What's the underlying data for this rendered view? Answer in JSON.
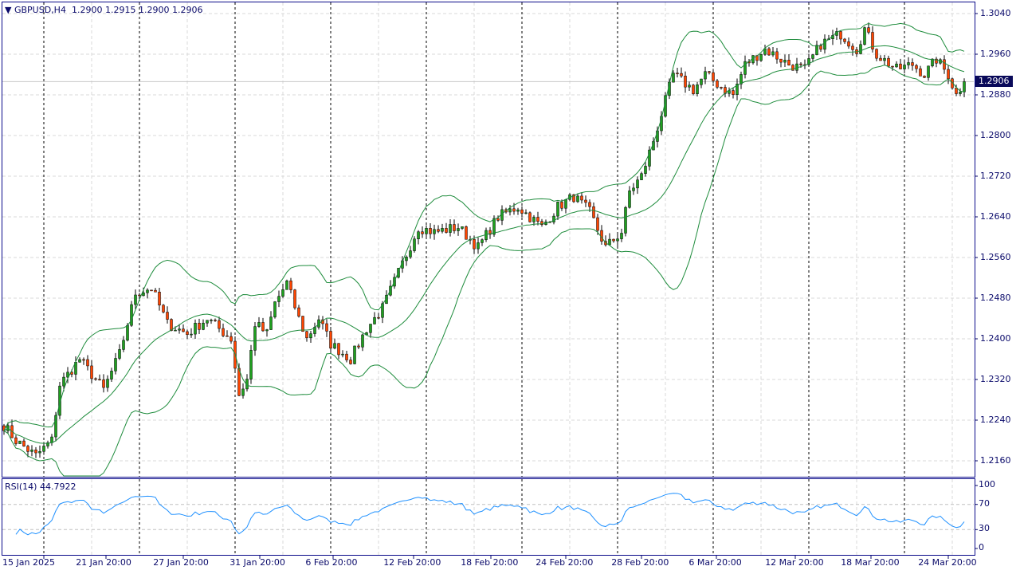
{
  "header": {
    "symbol": "GBPUSD,H4",
    "open": "1.2900",
    "high": "1.2915",
    "low": "1.2900",
    "close": "1.2906"
  },
  "current_price": "1.2906",
  "rsi": {
    "label": "RSI(14)",
    "value": "44.7922",
    "levels": [
      "100",
      "70",
      "30",
      "0"
    ]
  },
  "colors": {
    "bull": "#1ea01e",
    "bear": "#ff4500",
    "bands": "#1e8c3c",
    "rsi": "#1e90ff",
    "text": "#0a0a6a"
  },
  "chart_data": {
    "type": "candlestick",
    "title": "GBPUSD,H4",
    "y_ticks": [
      "1.3040",
      "1.2960",
      "1.2880",
      "1.2800",
      "1.2720",
      "1.2640",
      "1.2560",
      "1.2480",
      "1.2400",
      "1.2320",
      "1.2240",
      "1.2160"
    ],
    "ylim": [
      1.2104,
      1.3062
    ],
    "x_ticks": [
      "15 Jan 2025",
      "21 Jan 20:00",
      "27 Jan 20:00",
      "31 Jan 20:00",
      "6 Feb 20:00",
      "12 Feb 20:00",
      "18 Feb 20:00",
      "24 Feb 20:00",
      "28 Feb 20:00",
      "6 Mar 20:00",
      "12 Mar 20:00",
      "18 Mar 20:00",
      "24 Mar 20:00"
    ],
    "bar_count": 242,
    "close_path": [
      [
        0,
        1.223
      ],
      [
        3,
        1.22
      ],
      [
        8,
        1.217
      ],
      [
        12,
        1.22
      ],
      [
        14,
        1.231
      ],
      [
        19,
        1.236
      ],
      [
        25,
        1.23
      ],
      [
        29,
        1.237
      ],
      [
        33,
        1.249
      ],
      [
        37,
        1.25
      ],
      [
        41,
        1.243
      ],
      [
        46,
        1.241
      ],
      [
        51,
        1.244
      ],
      [
        57,
        1.24
      ],
      [
        59,
        1.229
      ],
      [
        61,
        1.232
      ],
      [
        63,
        1.243
      ],
      [
        66,
        1.241
      ],
      [
        68,
        1.247
      ],
      [
        71,
        1.251
      ],
      [
        74,
        1.244
      ],
      [
        76,
        1.24
      ],
      [
        79,
        1.244
      ],
      [
        82,
        1.239
      ],
      [
        87,
        1.236
      ],
      [
        91,
        1.242
      ],
      [
        95,
        1.246
      ],
      [
        99,
        1.253
      ],
      [
        104,
        1.262
      ],
      [
        108,
        1.261
      ],
      [
        114,
        1.262
      ],
      [
        119,
        1.258
      ],
      [
        124,
        1.264
      ],
      [
        129,
        1.266
      ],
      [
        135,
        1.262
      ],
      [
        139,
        1.266
      ],
      [
        143,
        1.268
      ],
      [
        147,
        1.265
      ],
      [
        151,
        1.258
      ],
      [
        155,
        1.261
      ],
      [
        157,
        1.269
      ],
      [
        160,
        1.272
      ],
      [
        163,
        1.279
      ],
      [
        168,
        1.292
      ],
      [
        173,
        1.289
      ],
      [
        176,
        1.292
      ],
      [
        181,
        1.289
      ],
      [
        183,
        1.288
      ],
      [
        186,
        1.294
      ],
      [
        191,
        1.297
      ],
      [
        197,
        1.294
      ],
      [
        201,
        1.293
      ],
      [
        205,
        1.298
      ],
      [
        210,
        1.3
      ],
      [
        214,
        1.297
      ],
      [
        216,
        1.301
      ],
      [
        219,
        1.296
      ],
      [
        224,
        1.293
      ],
      [
        228,
        1.294
      ],
      [
        231,
        1.292
      ],
      [
        234,
        1.295
      ],
      [
        237,
        1.292
      ],
      [
        239,
        1.288
      ],
      [
        241,
        1.2906
      ]
    ],
    "indicators": [
      "Bollinger Bands (20,2)",
      "RSI(14)"
    ]
  }
}
